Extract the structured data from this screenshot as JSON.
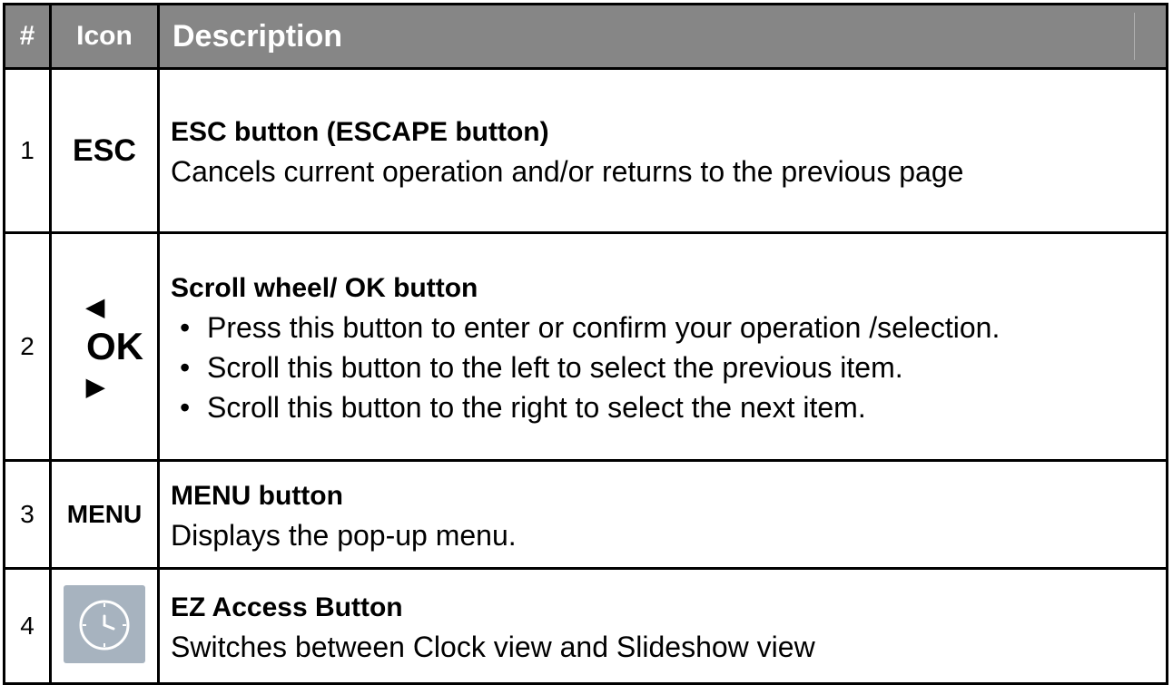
{
  "header": {
    "num": "#",
    "icon": "Icon",
    "description": "Description"
  },
  "rows": [
    {
      "num": "1",
      "icon_text": "ESC",
      "title": "ESC button (ESCAPE button)",
      "text": "Cancels current operation and/or returns to the previous page"
    },
    {
      "num": "2",
      "icon_text": "OK",
      "icon_arrows": [
        "◀",
        "▶"
      ],
      "title": "Scroll wheel/ OK button",
      "bullets": [
        "Press this button to enter or confirm your operation /selection.",
        "Scroll this button to the left to select the previous item.",
        "Scroll this button to the right to select the next item."
      ]
    },
    {
      "num": "3",
      "icon_text": "MENU",
      "title": "MENU button",
      "text": "Displays the pop-up menu."
    },
    {
      "num": "4",
      "icon_name": "clock-icon",
      "title": "EZ Access Button",
      "text": "Switches between Clock view and Slideshow view"
    }
  ],
  "colors": {
    "header_bg": "#868686",
    "header_text": "#ffffff",
    "clock_button_bg": "#a7b3bf"
  }
}
